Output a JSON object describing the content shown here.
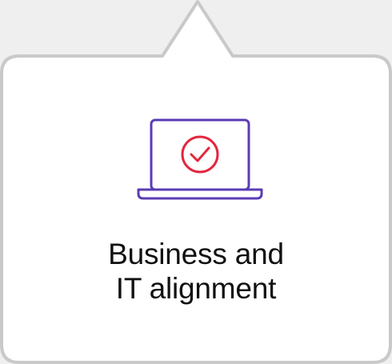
{
  "card": {
    "title_line_1": "Business and",
    "title_line_2": "IT alignment",
    "icon": "laptop-check-icon"
  },
  "colors": {
    "background": "#efefef",
    "card_fill": "#ffffff",
    "card_border": "#c9c9c9",
    "icon_outline": "#5b3cb4",
    "check_accent": "#e3263f",
    "text": "#111111"
  }
}
